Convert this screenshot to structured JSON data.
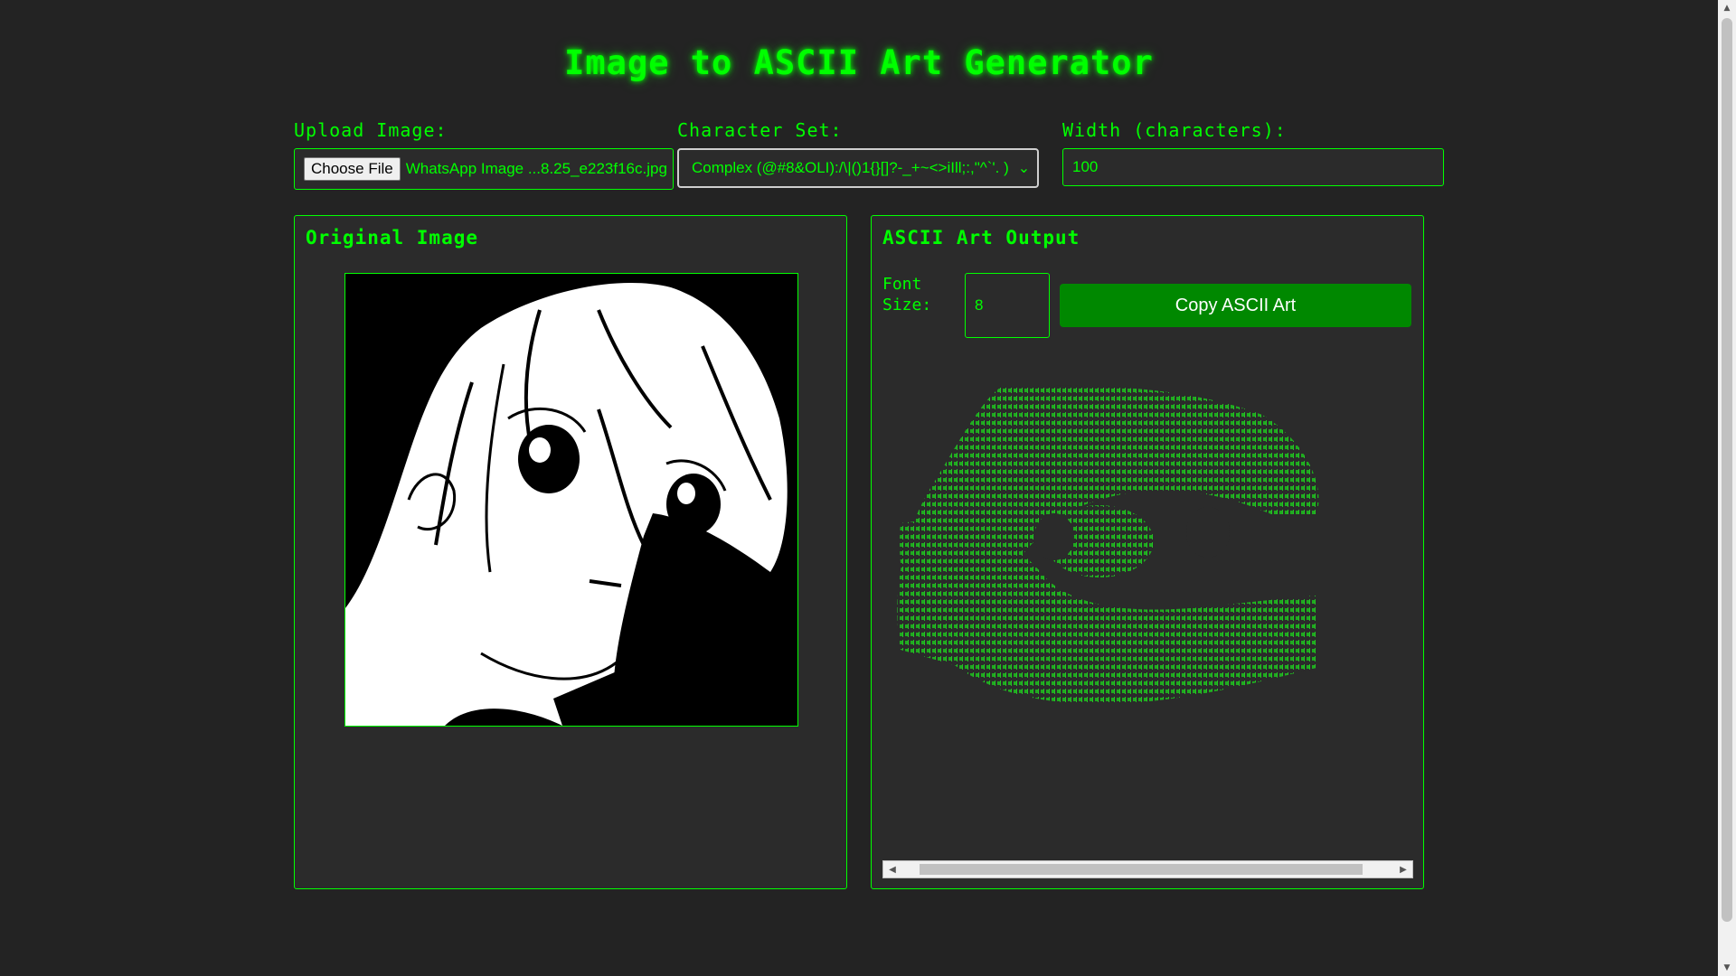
{
  "page_title": "Image to ASCII Art Generator",
  "upload": {
    "label": "Upload Image:",
    "button_label": "Choose File",
    "file_name": "WhatsApp Image ...8.25_e223f16c.jpg"
  },
  "charset": {
    "label": "Character Set:",
    "selected": "Complex (@#8&OLI):/\\|()1{}[]?-_+~<>iIll;:,\"^`'. )"
  },
  "width": {
    "label": "Width (characters):",
    "value": "100"
  },
  "original_panel": {
    "title": "Original Image"
  },
  "ascii_panel": {
    "title": "ASCII Art Output",
    "font_size_label": "Font Size:",
    "font_size_value": "8",
    "copy_button": "Copy ASCII Art"
  },
  "icons": {
    "select_chevron": "chevron-down-icon",
    "scroll_left": "scroll-left-arrow-icon",
    "scroll_right": "scroll-right-arrow-icon"
  },
  "colors": {
    "accent": "#00ff00",
    "background": "#232323",
    "panel": "#2b2b2b",
    "button": "#008800"
  }
}
